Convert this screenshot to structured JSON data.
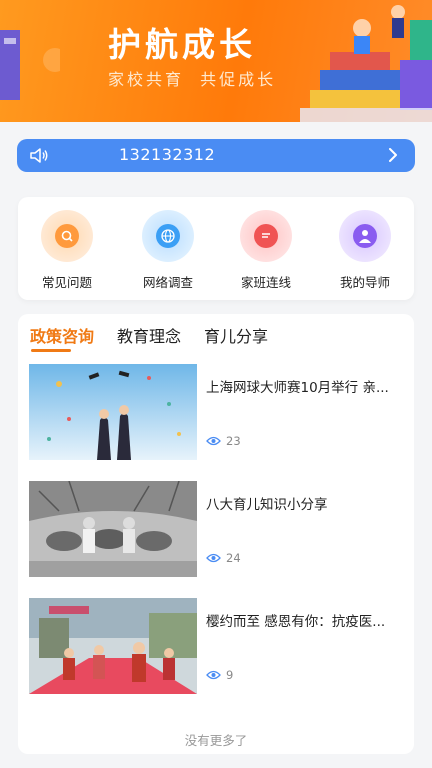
{
  "banner": {
    "title": "护航成长",
    "subtitle": "家校共育  共促成长"
  },
  "notice": {
    "text": "132132312",
    "icon": "speaker-icon",
    "chevron": "chevron-right-icon",
    "bg_color": "#4a8cf3"
  },
  "menu": [
    {
      "label": "常见问题",
      "icon": "faq-icon",
      "color": "#ff9a3d"
    },
    {
      "label": "网络调查",
      "icon": "globe-icon",
      "color": "#3b9ff5"
    },
    {
      "label": "家班连线",
      "icon": "chat-icon",
      "color": "#f05454"
    },
    {
      "label": "我的导师",
      "icon": "mentor-icon",
      "color": "#8a5cf0"
    }
  ],
  "tabs": [
    {
      "label": "政策咨询",
      "active": true
    },
    {
      "label": "教育理念",
      "active": false
    },
    {
      "label": "育儿分享",
      "active": false
    }
  ],
  "news": [
    {
      "title": "上海网球大师赛10月举行 亲...",
      "views": "23"
    },
    {
      "title": "八大育儿知识小分享",
      "views": "24"
    },
    {
      "title": "樱约而至 感恩有你：抗疫医...",
      "views": "9"
    }
  ],
  "footer": "没有更多了",
  "colors": {
    "accent": "#f07a15",
    "banner": "#ff8c1a"
  }
}
